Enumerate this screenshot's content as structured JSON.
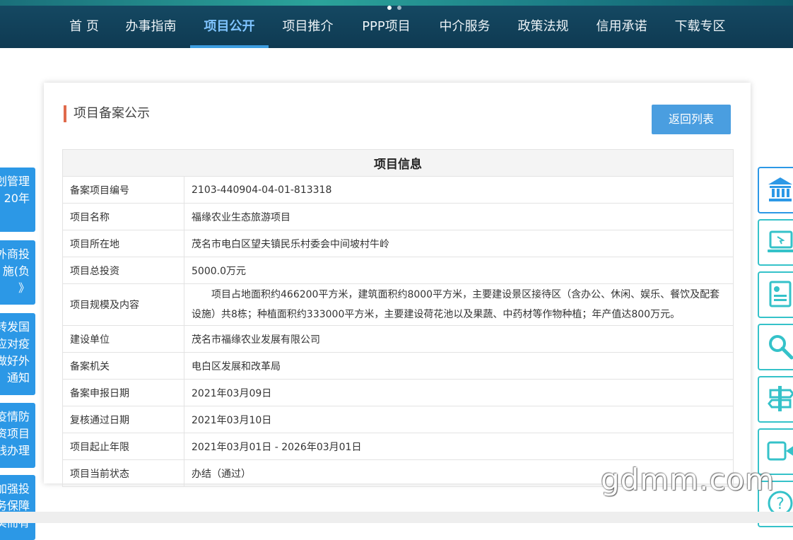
{
  "nav": {
    "items": [
      {
        "label": "首 页"
      },
      {
        "label": "办事指南"
      },
      {
        "label": "项目公开"
      },
      {
        "label": "项目推介"
      },
      {
        "label": "PPP项目"
      },
      {
        "label": "中介服务"
      },
      {
        "label": "政策法规"
      },
      {
        "label": "信用承诺"
      },
      {
        "label": "下载专区"
      }
    ],
    "active_index": 2
  },
  "section": {
    "title": "项目备案公示",
    "back_button": "返回列表"
  },
  "table": {
    "header": "项目信息",
    "rows": [
      {
        "key": "备案项目编号",
        "value": "2103-440904-04-01-813318"
      },
      {
        "key": "项目名称",
        "value": "福缘农业生态旅游项目"
      },
      {
        "key": "项目所在地",
        "value": "茂名市电白区望夫镇民乐村委会中间坡村牛岭"
      },
      {
        "key": "项目总投资",
        "value": "5000.0万元"
      },
      {
        "key": "项目规模及内容",
        "value": "项目占地面积约466200平方米，建筑面积约8000平方米，主要建设景区接待区（含办公、休闲、娱乐、餐饮及配套设施）共8栋；种植面积约333000平方米，主要建设荷花池以及果蔬、中药材等作物种植；年产值达800万元。"
      },
      {
        "key": "建设单位",
        "value": "茂名市福缘农业发展有限公司"
      },
      {
        "key": "备案机关",
        "value": "电白区发展和改革局"
      },
      {
        "key": "备案申报日期",
        "value": "2021年03月09日"
      },
      {
        "key": "复核通过日期",
        "value": "2021年03月10日"
      },
      {
        "key": "项目起止年限",
        "value": "2021年03月01日 - 2026年03月01日"
      },
      {
        "key": "项目当前状态",
        "value": "办结（通过）"
      }
    ]
  },
  "left_tabs": [
    {
      "lines": [
        "划管理",
        "20年"
      ]
    },
    {
      "lines": [
        "外商投",
        "施(负",
        "》"
      ]
    },
    {
      "lines": [
        "转发国",
        "应对疫",
        "做好外",
        "通知"
      ]
    },
    {
      "lines": [
        "疫情防",
        "资项目",
        "线办理"
      ]
    },
    {
      "lines": [
        "加强投",
        "务保障",
        "实而有"
      ]
    }
  ],
  "right_icons": [
    {
      "icon": "bank-icon"
    },
    {
      "icon": "computer-icon"
    },
    {
      "icon": "document-icon"
    },
    {
      "icon": "search-icon"
    },
    {
      "icon": "signpost-icon"
    },
    {
      "icon": "video-icon"
    },
    {
      "icon": "help-icon"
    }
  ],
  "watermark": "gdmm.com",
  "colors": {
    "nav_bg": "#0f3a52",
    "nav_active": "#3d9de0",
    "accent": "#e06a4c",
    "button": "#4a9ee0",
    "tab_blue": "#2c98e6",
    "icon_teal": "#35c2c9"
  }
}
